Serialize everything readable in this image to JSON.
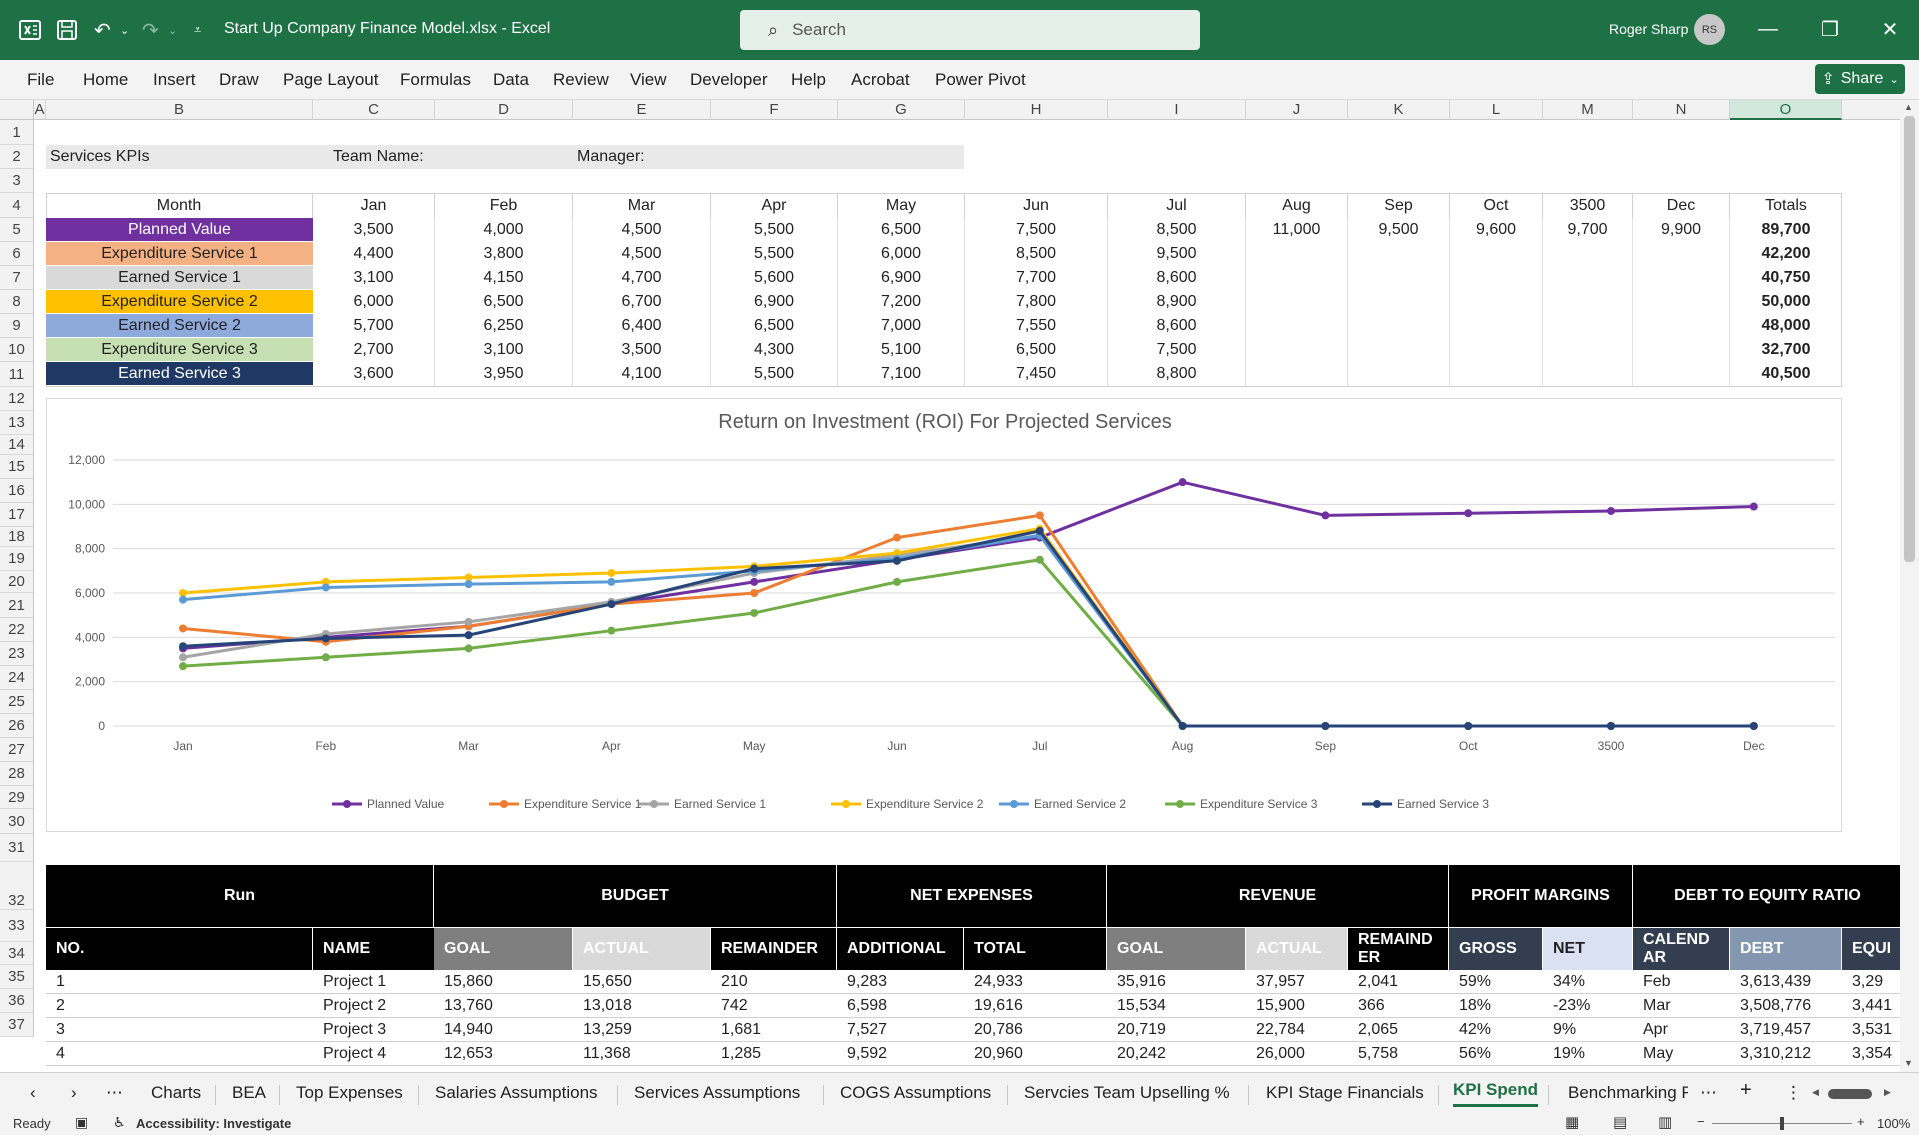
{
  "app": {
    "doc_title": "Start Up Company Finance Model.xlsx  -  Excel",
    "search_placeholder": "Search",
    "user_name": "Roger Sharp",
    "user_initials": "RS",
    "share_label": "Share"
  },
  "menu": [
    "File",
    "Home",
    "Insert",
    "Draw",
    "Page Layout",
    "Formulas",
    "Data",
    "Review",
    "View",
    "Developer",
    "Help",
    "Acrobat",
    "Power Pivot"
  ],
  "columns": [
    "A",
    "B",
    "C",
    "D",
    "E",
    "F",
    "G",
    "H",
    "I",
    "J",
    "K",
    "L",
    "M",
    "N",
    "O"
  ],
  "rows": [
    "1",
    "2",
    "3",
    "4",
    "5",
    "6",
    "7",
    "8",
    "9",
    "10",
    "11",
    "12",
    "13",
    "14",
    "15",
    "16",
    "17",
    "18",
    "19",
    "20",
    "21",
    "22",
    "23",
    "24",
    "25",
    "26",
    "27",
    "28",
    "29",
    "30",
    "31",
    "32",
    "33",
    "34",
    "35",
    "36",
    "37"
  ],
  "header_row": {
    "services_kpis": "Services KPIs",
    "team_name": "Team Name:",
    "manager": "Manager:"
  },
  "kpi_table": {
    "month_label": "Month",
    "months": [
      "Jan",
      "Feb",
      "Mar",
      "Apr",
      "May",
      "Jun",
      "Jul",
      "Aug",
      "Sep",
      "Oct",
      "3500",
      "Dec"
    ],
    "totals_label": "Totals",
    "rows": [
      {
        "label": "Planned Value",
        "color": "#7030a0",
        "text_color": "#ffffff",
        "values": [
          "3,500",
          "4,000",
          "4,500",
          "5,500",
          "6,500",
          "7,500",
          "8,500",
          "11,000",
          "9,500",
          "9,600",
          "9,700",
          "9,900"
        ],
        "total": "89,700"
      },
      {
        "label": "Expenditure Service 1",
        "color": "#f4b183",
        "text_color": "#222222",
        "values": [
          "4,400",
          "3,800",
          "4,500",
          "5,500",
          "6,000",
          "8,500",
          "9,500",
          "",
          "",
          "",
          "",
          ""
        ],
        "total": "42,200"
      },
      {
        "label": "Earned Service 1",
        "color": "#d9d9d9",
        "text_color": "#222222",
        "values": [
          "3,100",
          "4,150",
          "4,700",
          "5,600",
          "6,900",
          "7,700",
          "8,600",
          "",
          "",
          "",
          "",
          ""
        ],
        "total": "40,750"
      },
      {
        "label": "Expenditure Service 2",
        "color": "#ffc000",
        "text_color": "#222222",
        "values": [
          "6,000",
          "6,500",
          "6,700",
          "6,900",
          "7,200",
          "7,800",
          "8,900",
          "",
          "",
          "",
          "",
          ""
        ],
        "total": "50,000"
      },
      {
        "label": "Earned Service 2",
        "color": "#8ea9db",
        "text_color": "#222222",
        "values": [
          "5,700",
          "6,250",
          "6,400",
          "6,500",
          "7,000",
          "7,550",
          "8,600",
          "",
          "",
          "",
          "",
          ""
        ],
        "total": "48,000"
      },
      {
        "label": "Expenditure Service 3",
        "color": "#c6e0b4",
        "text_color": "#222222",
        "values": [
          "2,700",
          "3,100",
          "3,500",
          "4,300",
          "5,100",
          "6,500",
          "7,500",
          "",
          "",
          "",
          "",
          ""
        ],
        "total": "32,700"
      },
      {
        "label": "Earned Service 3",
        "color": "#203864",
        "text_color": "#ffffff",
        "values": [
          "3,600",
          "3,950",
          "4,100",
          "5,500",
          "7,100",
          "7,450",
          "8,800",
          "",
          "",
          "",
          "",
          ""
        ],
        "total": "40,500"
      }
    ]
  },
  "chart_data": {
    "type": "line",
    "title": "Return on Investment (ROI) For Projected Services",
    "categories": [
      "Jan",
      "Feb",
      "Mar",
      "Apr",
      "May",
      "Jun",
      "Jul",
      "Aug",
      "Sep",
      "Oct",
      "3500",
      "Dec"
    ],
    "ylim": [
      0,
      12000
    ],
    "yticks": [
      "0",
      "2,000",
      "4,000",
      "6,000",
      "8,000",
      "10,000",
      "12,000"
    ],
    "grid": true,
    "legend": "bottom",
    "series": [
      {
        "name": "Planned Value",
        "color": "#7030a0",
        "values": [
          3500,
          4000,
          4500,
          5500,
          6500,
          7500,
          8500,
          11000,
          9500,
          9600,
          9700,
          9900
        ]
      },
      {
        "name": "Expenditure Service 1",
        "color": "#ed7d31",
        "values": [
          4400,
          3800,
          4500,
          5500,
          6000,
          8500,
          9500,
          0,
          0,
          0,
          0,
          0
        ]
      },
      {
        "name": "Earned Service 1",
        "color": "#a5a5a5",
        "values": [
          3100,
          4150,
          4700,
          5600,
          6900,
          7700,
          8600,
          0,
          0,
          0,
          0,
          0
        ]
      },
      {
        "name": "Expenditure Service 2",
        "color": "#ffc000",
        "values": [
          6000,
          6500,
          6700,
          6900,
          7200,
          7800,
          8900,
          0,
          0,
          0,
          0,
          0
        ]
      },
      {
        "name": "Earned Service 2",
        "color": "#5b9bd5",
        "values": [
          5700,
          6250,
          6400,
          6500,
          7000,
          7550,
          8600,
          0,
          0,
          0,
          0,
          0
        ]
      },
      {
        "name": "Expenditure Service 3",
        "color": "#70ad47",
        "values": [
          2700,
          3100,
          3500,
          4300,
          5100,
          6500,
          7500,
          0,
          0,
          0,
          0,
          0
        ]
      },
      {
        "name": "Earned Service 3",
        "color": "#264478",
        "values": [
          3600,
          3950,
          4100,
          5500,
          7100,
          7450,
          8800,
          0,
          0,
          0,
          0,
          0
        ]
      }
    ]
  },
  "run_table": {
    "groups": [
      "Run",
      "BUDGET",
      "NET EXPENSES",
      "REVENUE",
      "PROFIT MARGINS",
      "DEBT TO EQUITY RATIO"
    ],
    "subheaders": [
      "NO.",
      "NAME",
      "GOAL",
      "ACTUAL",
      "REMAINDER",
      "ADDITIONAL",
      "TOTAL",
      "GOAL",
      "ACTUAL",
      "REMAIND ER",
      "GROSS",
      "NET",
      "CALEND AR",
      "DEBT",
      "EQUI"
    ],
    "rows": [
      [
        "1",
        "Project 1",
        "15,860",
        "15,650",
        "210",
        "9,283",
        "24,933",
        "35,916",
        "37,957",
        "2,041",
        "59%",
        "34%",
        "Feb",
        "3,613,439",
        "3,29"
      ],
      [
        "2",
        "Project 2",
        "13,760",
        "13,018",
        "742",
        "6,598",
        "19,616",
        "15,534",
        "15,900",
        "366",
        "18%",
        "-23%",
        "Mar",
        "3,508,776",
        "3,441"
      ],
      [
        "3",
        "Project 3",
        "14,940",
        "13,259",
        "1,681",
        "7,527",
        "20,786",
        "20,719",
        "22,784",
        "2,065",
        "42%",
        "9%",
        "Apr",
        "3,719,457",
        "3,531"
      ],
      [
        "4",
        "Project 4",
        "12,653",
        "11,368",
        "1,285",
        "9,592",
        "20,960",
        "20,242",
        "26,000",
        "5,758",
        "56%",
        "19%",
        "May",
        "3,310,212",
        "3,354"
      ]
    ]
  },
  "tabs": [
    "Charts",
    "BEA",
    "Top Expenses",
    "Salaries Assumptions",
    "Services Assumptions",
    "COGS Assumptions",
    "Servcies Team Upselling %",
    "KPI Stage Financials",
    "KPI Spend",
    "Benchmarking F"
  ],
  "active_tab": "KPI Spend",
  "status": {
    "ready": "Ready",
    "accessibility": "Accessibility: Investigate",
    "zoom": "100%"
  }
}
